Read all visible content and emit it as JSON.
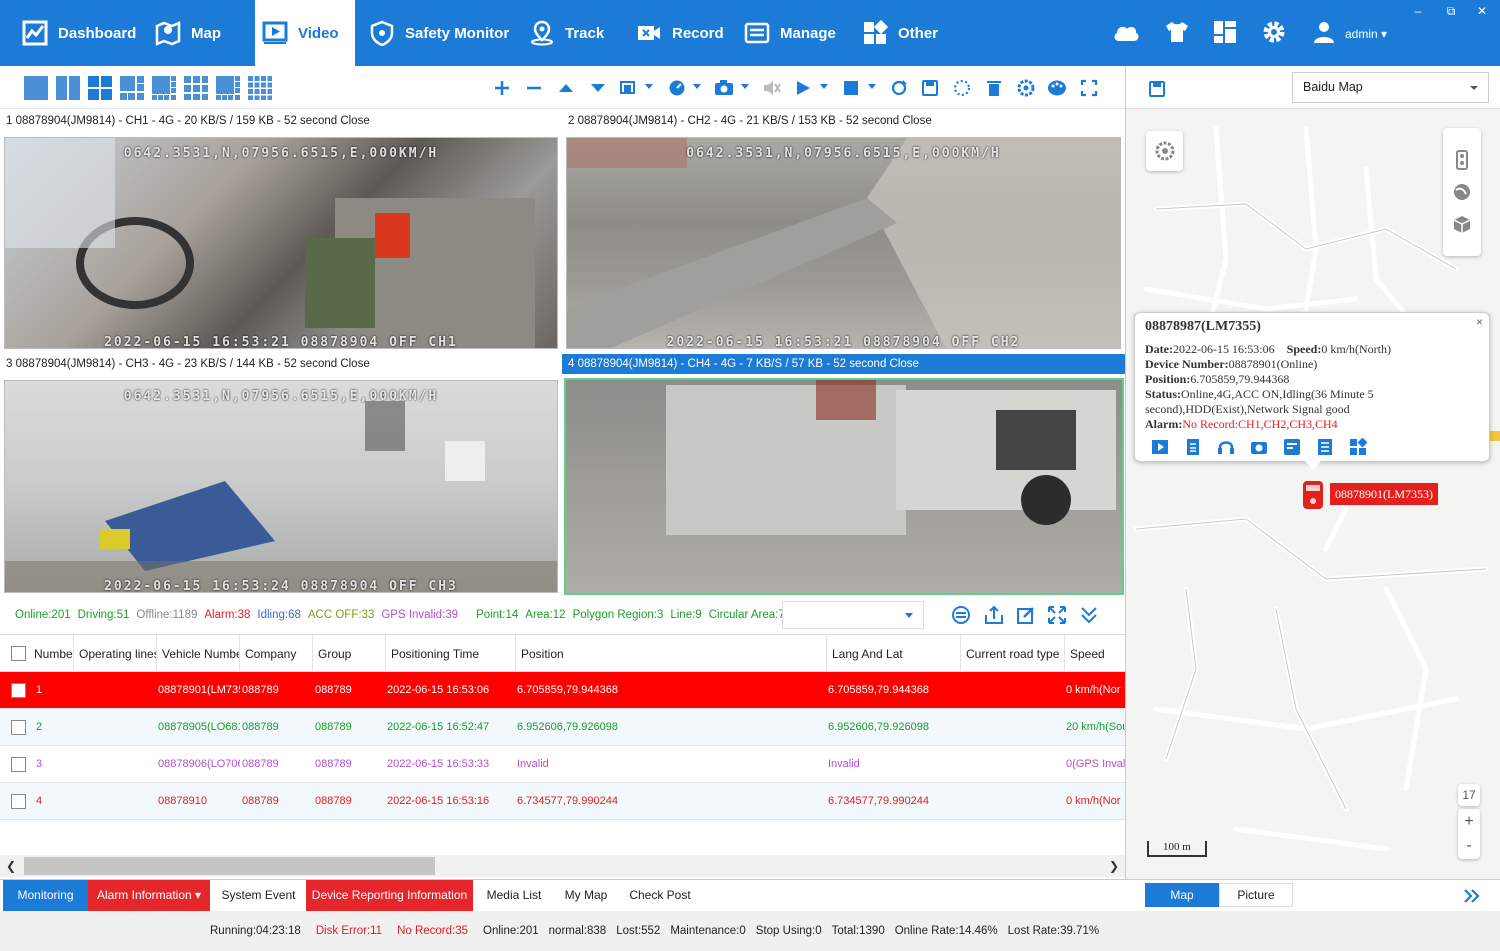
{
  "nav": {
    "items": [
      {
        "label": "Dashboard"
      },
      {
        "label": "Map"
      },
      {
        "label": "Video"
      },
      {
        "label": "Safety Monitor"
      },
      {
        "label": "Track"
      },
      {
        "label": "Record"
      },
      {
        "label": "Manage"
      },
      {
        "label": "Other"
      }
    ],
    "active": "Video",
    "user": "admin ▾",
    "window_controls": [
      "–",
      "⧉",
      "✕"
    ]
  },
  "videos": [
    {
      "title": "1  08878904(JM9814) - CH1 - 4G - 20 KB/S / 159 KB - 52 second Close",
      "osd_top": "0642.3531,N,07956.6515,E,000KM/H",
      "osd_bottom": "2022-06-15 16:53:21 08878904 OFF CH1"
    },
    {
      "title": "2  08878904(JM9814) - CH2 - 4G - 21 KB/S / 153 KB - 52 second Close",
      "osd_top": "0642.3531,N,07956.6515,E,000KM/H",
      "osd_bottom": "2022-06-15 16:53:21 08878904 OFF CH2"
    },
    {
      "title": "3  08878904(JM9814) - CH3 - 4G - 23 KB/S / 144 KB - 52 second Close",
      "osd_top": "0642.3531,N,07956.6515,E,000KM/H",
      "osd_bottom": "2022-06-15 16:53:24 08878904 OFF CH3"
    },
    {
      "title": "4  08878904(JM9814) - CH4 - 4G - 7 KB/S / 57 KB - 52 second Close",
      "osd_top": "",
      "osd_bottom": ""
    }
  ],
  "stats": {
    "online": "Online:201",
    "driving": "Driving:51",
    "offline": "Offline:1189",
    "alarm": "Alarm:38",
    "idling": "Idling:68",
    "acc_off": "ACC OFF:33",
    "gps_invalid": "GPS Invalid:39",
    "point": "Point:14",
    "area": "Area:12",
    "polygon": "Polygon Region:3",
    "line": "Line:9",
    "circular": "Circular Area:7"
  },
  "table": {
    "headers": [
      "Numbe",
      "Operating lines",
      "Vehicle Numbe",
      "Company",
      "Group",
      "Positioning Time",
      "Position",
      "Lang And Lat",
      "Current road type",
      "Speed"
    ],
    "rows": [
      {
        "num": "1",
        "vehicle": "08878901(LM735",
        "company": "088789",
        "group": "088789",
        "time": "2022-06-15 16:53:06",
        "position": "6.705859,79.944368",
        "latlng": "6.705859,79.944368",
        "speed": "0 km/h(Nor"
      },
      {
        "num": "2",
        "vehicle": "08878905(LO681",
        "company": "088789",
        "group": "088789",
        "time": "2022-06-15 16:52:47",
        "position": "6.952606,79.926098",
        "latlng": "6.952606,79.926098",
        "speed": "20 km/h(Sou"
      },
      {
        "num": "3",
        "vehicle": "08878906(LO706",
        "company": "088789",
        "group": "088789",
        "time": "2022-06-15 16:53:33",
        "position": "Invalid",
        "latlng": "Invalid",
        "speed": "0(GPS Invali"
      },
      {
        "num": "4",
        "vehicle": "08878910",
        "company": "088789",
        "group": "088789",
        "time": "2022-06-15 16:53:16",
        "position": "6.734577,79.990244",
        "latlng": "6.734577,79.990244",
        "speed": "0 km/h(Nor"
      }
    ]
  },
  "bottom_tabs": [
    "Monitoring",
    "Alarm Information ▾",
    "System Event",
    "Device Reporting Information",
    "Media List",
    "My Map",
    "Check Post"
  ],
  "statusbar": {
    "running": "Running:04:23:18",
    "disk_error": "Disk Error:11",
    "no_record": "No Record:35",
    "online": "Online:201",
    "normal": "normal:838",
    "lost": "Lost:552",
    "maintenance": "Maintenance:0",
    "stop_using": "Stop Using:0",
    "total": "Total:1390",
    "online_rate": "Online Rate:14.46%",
    "lost_rate": "Lost Rate:39.71%"
  },
  "map": {
    "provider": "Baidu Map",
    "popup": {
      "title": "08878987(LM7355)",
      "date_label": "Date:",
      "date": "2022-06-15 16:53:06",
      "speed_label": "Speed:",
      "speed": "0 km/h(North)",
      "device_label": "Device Number:",
      "device": "08878901(Online)",
      "position_label": "Position:",
      "position": "6.705859,79.944368",
      "status_label": "Status:",
      "status": "Online,4G,ACC ON,Idling(36 Minute 5 second),HDD(Exist),Network Signal good",
      "alarm_label": "Alarm:",
      "alarm": "No Record:CH1,CH2,CH3,CH4",
      "close": "×"
    },
    "car_label": "08878901(LM7353)",
    "zoom_level": "17",
    "zoom_in": "+",
    "zoom_out": "-",
    "scale": "100 m",
    "tabs": [
      "Map",
      "Picture"
    ]
  },
  "colors": {
    "brand": "#1d7bd8",
    "alarm_row": "#ff0000",
    "green": "#1a9e2a",
    "purple": "#b34fd1",
    "red": "#e02020"
  }
}
